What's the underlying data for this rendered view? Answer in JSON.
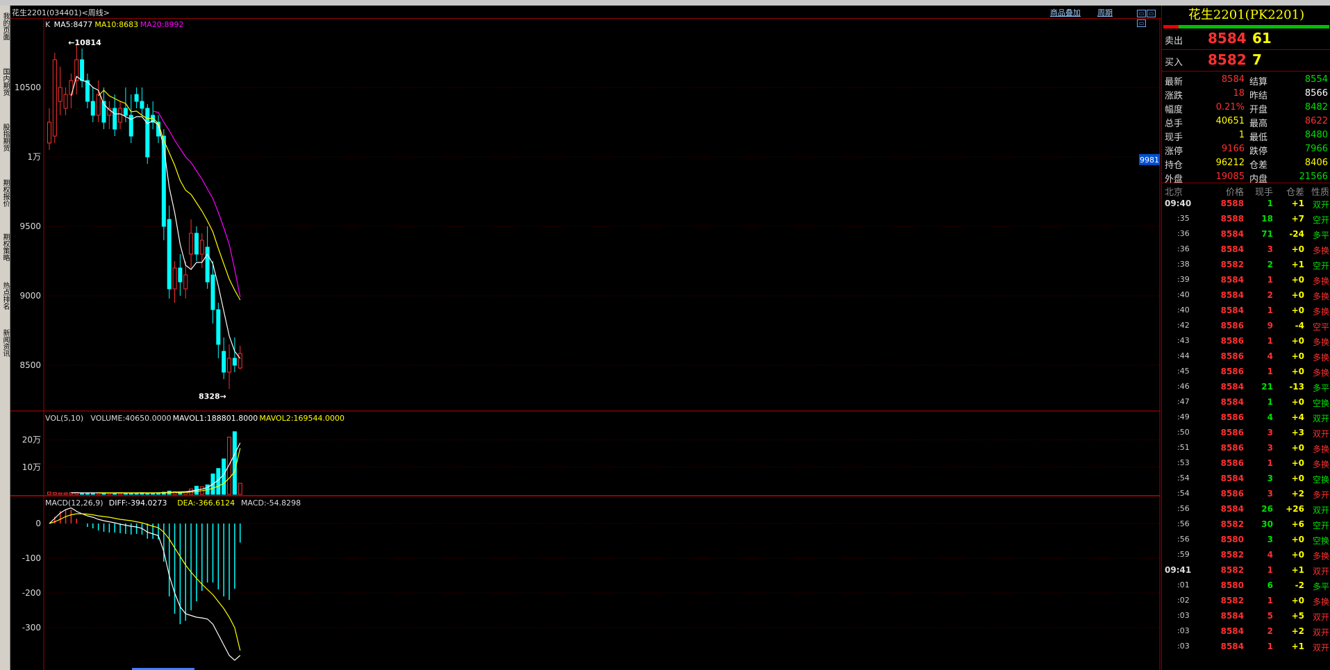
{
  "window": {
    "title": "花生2201(034401)<周线>",
    "links": [
      "商品叠加",
      "周期"
    ]
  },
  "sidebar": {
    "tabs": [
      "我的页面",
      "国内期货",
      "股指期货",
      "期权报价",
      "期权策略",
      "热点排名",
      "新闻资讯"
    ]
  },
  "main_chart": {
    "legend_k": "K",
    "ma5_label": "MA5:8477",
    "ma10_label": "MA10:8683",
    "ma20_label": "MA20:8992",
    "high_annotation": "10814",
    "low_annotation": "8328",
    "y_ticks": [
      {
        "value": 10500,
        "label": "10500"
      },
      {
        "value": 10000,
        "label": "1万"
      },
      {
        "value": 9500,
        "label": "9500"
      },
      {
        "value": 9000,
        "label": "9000"
      },
      {
        "value": 8500,
        "label": "8500"
      }
    ],
    "right_price_tag": "9981",
    "colors": {
      "up": "#ff3030",
      "down": "#00ffff",
      "ma5": "#ffffff",
      "ma10": "#ffff00",
      "ma20": "#ff00ff"
    }
  },
  "vol_panel": {
    "legend_vol": "VOL(5,10)",
    "legend_volume": "VOLUME:40650.0000",
    "legend_mavol1": "MAVOL1:188801.8000",
    "legend_mavol2": "MAVOL2:169544.0000",
    "y_ticks": [
      {
        "value": 200000,
        "label": "20万"
      },
      {
        "value": 100000,
        "label": "10万"
      }
    ]
  },
  "macd_panel": {
    "legend_macd": "MACD(12,26,9)",
    "legend_diff": "DIFF:-394.0273",
    "legend_dea": "DEA:-366.6124",
    "legend_val": "MACD:-54.8298",
    "y_ticks": [
      {
        "value": 0,
        "label": "0"
      },
      {
        "value": -100,
        "label": "-100"
      },
      {
        "value": -200,
        "label": "-200"
      },
      {
        "value": -300,
        "label": "-300"
      }
    ]
  },
  "chart_data": {
    "type": "candlestick",
    "instrument": "花生2201(034401)",
    "period": "周线",
    "ylim": [
      8300,
      10900
    ],
    "high": 10814,
    "low": 8328,
    "candles": [
      {
        "o": 10100,
        "h": 10350,
        "l": 10050,
        "c": 10250
      },
      {
        "o": 10150,
        "h": 10750,
        "l": 10100,
        "c": 10700
      },
      {
        "o": 10400,
        "h": 10650,
        "l": 10300,
        "c": 10500
      },
      {
        "o": 10350,
        "h": 10500,
        "l": 10300,
        "c": 10450
      },
      {
        "o": 10450,
        "h": 10600,
        "l": 10350,
        "c": 10550
      },
      {
        "o": 10550,
        "h": 10814,
        "l": 10450,
        "c": 10700
      },
      {
        "o": 10700,
        "h": 10780,
        "l": 10500,
        "c": 10550
      },
      {
        "o": 10550,
        "h": 10600,
        "l": 10350,
        "c": 10400
      },
      {
        "o": 10400,
        "h": 10500,
        "l": 10250,
        "c": 10300
      },
      {
        "o": 10300,
        "h": 10550,
        "l": 10250,
        "c": 10450
      },
      {
        "o": 10400,
        "h": 10500,
        "l": 10200,
        "c": 10250
      },
      {
        "o": 10300,
        "h": 10400,
        "l": 10200,
        "c": 10350
      },
      {
        "o": 10350,
        "h": 10450,
        "l": 10150,
        "c": 10200
      },
      {
        "o": 10250,
        "h": 10400,
        "l": 10200,
        "c": 10350
      },
      {
        "o": 10350,
        "h": 10500,
        "l": 10250,
        "c": 10300
      },
      {
        "o": 10300,
        "h": 10450,
        "l": 10100,
        "c": 10150
      },
      {
        "o": 10450,
        "h": 10500,
        "l": 10350,
        "c": 10400
      },
      {
        "o": 10400,
        "h": 10500,
        "l": 10300,
        "c": 10350
      },
      {
        "o": 10350,
        "h": 10380,
        "l": 9950,
        "c": 10000
      },
      {
        "o": 10300,
        "h": 10400,
        "l": 10200,
        "c": 10250
      },
      {
        "o": 10250,
        "h": 10300,
        "l": 10100,
        "c": 10150
      },
      {
        "o": 10150,
        "h": 10200,
        "l": 9400,
        "c": 9500
      },
      {
        "o": 9550,
        "h": 9650,
        "l": 8980,
        "c": 9050
      },
      {
        "o": 9050,
        "h": 9250,
        "l": 8950,
        "c": 9200
      },
      {
        "o": 9200,
        "h": 9300,
        "l": 9000,
        "c": 9100
      },
      {
        "o": 9050,
        "h": 9250,
        "l": 8980,
        "c": 9150
      },
      {
        "o": 9300,
        "h": 9550,
        "l": 9200,
        "c": 9450
      },
      {
        "o": 9450,
        "h": 9500,
        "l": 9250,
        "c": 9300
      },
      {
        "o": 9300,
        "h": 9450,
        "l": 9200,
        "c": 9400
      },
      {
        "o": 9350,
        "h": 9500,
        "l": 9050,
        "c": 9100
      },
      {
        "o": 9150,
        "h": 9250,
        "l": 8800,
        "c": 8900
      },
      {
        "o": 8900,
        "h": 8950,
        "l": 8550,
        "c": 8650
      },
      {
        "o": 8600,
        "h": 8700,
        "l": 8400,
        "c": 8450
      },
      {
        "o": 8450,
        "h": 8650,
        "l": 8328,
        "c": 8550
      },
      {
        "o": 8550,
        "h": 8700,
        "l": 8450,
        "c": 8500
      },
      {
        "o": 8480,
        "h": 8640,
        "l": 8470,
        "c": 8584
      }
    ],
    "ma5": [
      null,
      null,
      null,
      null,
      10440,
      10580,
      10550,
      10540,
      10500,
      10480,
      10380,
      10340,
      10310,
      10310,
      10290,
      10270,
      10290,
      10290,
      10240,
      10260,
      10230,
      10070,
      9780,
      9600,
      9370,
      9220,
      9190,
      9240,
      9240,
      9300,
      9230,
      9070,
      8890,
      8710,
      8600,
      8548
    ],
    "ma10": [
      null,
      null,
      null,
      null,
      null,
      null,
      null,
      null,
      null,
      10440,
      10480,
      10440,
      10420,
      10400,
      10385,
      10325,
      10330,
      10300,
      10275,
      10280,
      10240,
      10120,
      10030,
      9940,
      9830,
      9760,
      9730,
      9670,
      9610,
      9540,
      9460,
      9340,
      9230,
      9120,
      9040,
      8970
    ],
    "ma20": [
      null,
      null,
      null,
      null,
      null,
      null,
      null,
      null,
      null,
      null,
      null,
      null,
      null,
      null,
      null,
      null,
      null,
      null,
      null,
      10330,
      10320,
      10250,
      10190,
      10120,
      10060,
      10000,
      9960,
      9900,
      9840,
      9770,
      9700,
      9600,
      9490,
      9370,
      9190,
      8992
    ],
    "volume": [
      8000,
      6000,
      5000,
      5000,
      6000,
      7000,
      5000,
      5000,
      5000,
      6000,
      5000,
      5000,
      5000,
      6000,
      5000,
      5000,
      5000,
      6000,
      5000,
      5000,
      6000,
      8000,
      12000,
      10000,
      9000,
      10000,
      20000,
      30000,
      28000,
      35000,
      75000,
      95000,
      130000,
      210000,
      230000,
      40650
    ],
    "mavol1": [
      null,
      null,
      null,
      null,
      6000,
      5800,
      5600,
      5600,
      5600,
      5600,
      5200,
      5200,
      5200,
      5400,
      5200,
      5200,
      5200,
      5400,
      5200,
      5200,
      5400,
      6000,
      7200,
      8200,
      9000,
      9800,
      12200,
      15800,
      19400,
      24600,
      37600,
      52600,
      72600,
      109000,
      148000,
      188802
    ],
    "mavol2": [
      null,
      null,
      null,
      null,
      null,
      null,
      null,
      null,
      null,
      5800,
      5500,
      5400,
      5400,
      5500,
      5400,
      5300,
      5300,
      5400,
      5300,
      5300,
      5300,
      5600,
      6300,
      6800,
      7100,
      7500,
      8700,
      11000,
      13300,
      16700,
      22500,
      30300,
      39900,
      59600,
      83300,
      169544
    ],
    "diff": [
      0,
      15,
      30,
      40,
      45,
      35,
      28,
      22,
      18,
      12,
      8,
      5,
      2,
      -2,
      -5,
      -8,
      -10,
      -14,
      -25,
      -30,
      -35,
      -80,
      -150,
      -200,
      -240,
      -260,
      -265,
      -270,
      -272,
      -275,
      -290,
      -320,
      -350,
      -380,
      -394,
      -380
    ],
    "dea": [
      0,
      5,
      12,
      20,
      25,
      28,
      28,
      27,
      25,
      22,
      20,
      18,
      15,
      12,
      10,
      8,
      5,
      2,
      -3,
      -8,
      -12,
      -25,
      -45,
      -70,
      -95,
      -120,
      -140,
      -158,
      -175,
      -190,
      -205,
      -225,
      -245,
      -270,
      -300,
      -366
    ],
    "macd": [
      0,
      20,
      36,
      40,
      40,
      14,
      0,
      -10,
      -14,
      -20,
      -24,
      -26,
      -26,
      -28,
      -30,
      -32,
      -30,
      -32,
      -44,
      -44,
      -46,
      -110,
      -210,
      -260,
      -290,
      -280,
      -250,
      -224,
      -194,
      -170,
      -170,
      -190,
      -210,
      -220,
      -188,
      -55
    ]
  },
  "quote_panel": {
    "title": "花生2201(PK2201)",
    "ask_label": "卖出",
    "ask_price": "8584",
    "ask_vol": "61",
    "bid_label": "买入",
    "bid_price": "8582",
    "bid_vol": "7",
    "rows": [
      {
        "l1": "最新",
        "v1": "8584",
        "c1": "red",
        "l2": "结算",
        "v2": "8554",
        "c2": "green"
      },
      {
        "l1": "涨跌",
        "v1": "18",
        "c1": "red",
        "l2": "昨结",
        "v2": "8566",
        "c2": "white"
      },
      {
        "l1": "幅度",
        "v1": "0.21%",
        "c1": "red",
        "l2": "开盘",
        "v2": "8482",
        "c2": "green"
      },
      {
        "l1": "总手",
        "v1": "40651",
        "c1": "yellow",
        "l2": "最高",
        "v2": "8622",
        "c2": "red"
      },
      {
        "l1": "现手",
        "v1": "1",
        "c1": "yellow",
        "l2": "最低",
        "v2": "8480",
        "c2": "green"
      },
      {
        "l1": "涨停",
        "v1": "9166",
        "c1": "red",
        "l2": "跌停",
        "v2": "7966",
        "c2": "green"
      },
      {
        "l1": "持仓",
        "v1": "96212",
        "c1": "yellow",
        "l2": "仓差",
        "v2": "8406",
        "c2": "yellow"
      },
      {
        "l1": "外盘",
        "v1": "19085",
        "c1": "red",
        "l2": "内盘",
        "v2": "21566",
        "c2": "green"
      }
    ],
    "tick_headers": [
      "北京",
      "价格",
      "现手",
      "仓差",
      "性质"
    ],
    "ticks": [
      {
        "t": "09:40",
        "p": "8588",
        "v": "1",
        "vc": "green",
        "oi": "+1",
        "n": "双开",
        "nc": "green",
        "main": true
      },
      {
        "t": ":35",
        "p": "8588",
        "v": "18",
        "vc": "green",
        "oi": "+7",
        "n": "空开",
        "nc": "green"
      },
      {
        "t": ":36",
        "p": "8584",
        "v": "71",
        "vc": "green",
        "oi": "-24",
        "n": "多平",
        "nc": "green"
      },
      {
        "t": ":36",
        "p": "8584",
        "v": "3",
        "vc": "red",
        "oi": "+0",
        "n": "多换",
        "nc": "red"
      },
      {
        "t": ":38",
        "p": "8582",
        "v": "2",
        "vc": "green",
        "oi": "+1",
        "n": "空开",
        "nc": "green"
      },
      {
        "t": ":39",
        "p": "8584",
        "v": "1",
        "vc": "red",
        "oi": "+0",
        "n": "多换",
        "nc": "red"
      },
      {
        "t": ":40",
        "p": "8584",
        "v": "2",
        "vc": "red",
        "oi": "+0",
        "n": "多换",
        "nc": "red"
      },
      {
        "t": ":40",
        "p": "8584",
        "v": "1",
        "vc": "red",
        "oi": "+0",
        "n": "多换",
        "nc": "red"
      },
      {
        "t": ":42",
        "p": "8586",
        "v": "9",
        "vc": "red",
        "oi": "-4",
        "n": "空平",
        "nc": "red"
      },
      {
        "t": ":43",
        "p": "8586",
        "v": "1",
        "vc": "red",
        "oi": "+0",
        "n": "多换",
        "nc": "red"
      },
      {
        "t": ":44",
        "p": "8586",
        "v": "4",
        "vc": "red",
        "oi": "+0",
        "n": "多换",
        "nc": "red"
      },
      {
        "t": ":45",
        "p": "8586",
        "v": "1",
        "vc": "red",
        "oi": "+0",
        "n": "多换",
        "nc": "red"
      },
      {
        "t": ":46",
        "p": "8584",
        "v": "21",
        "vc": "green",
        "oi": "-13",
        "n": "多平",
        "nc": "green"
      },
      {
        "t": ":47",
        "p": "8584",
        "v": "1",
        "vc": "green",
        "oi": "+0",
        "n": "空换",
        "nc": "green"
      },
      {
        "t": ":49",
        "p": "8586",
        "v": "4",
        "vc": "green",
        "oi": "+4",
        "n": "双开",
        "nc": "green"
      },
      {
        "t": ":50",
        "p": "8586",
        "v": "3",
        "vc": "red",
        "oi": "+3",
        "n": "双开",
        "nc": "red"
      },
      {
        "t": ":51",
        "p": "8586",
        "v": "3",
        "vc": "red",
        "oi": "+0",
        "n": "多换",
        "nc": "red"
      },
      {
        "t": ":53",
        "p": "8586",
        "v": "1",
        "vc": "red",
        "oi": "+0",
        "n": "多换",
        "nc": "red"
      },
      {
        "t": ":54",
        "p": "8584",
        "v": "3",
        "vc": "green",
        "oi": "+0",
        "n": "空换",
        "nc": "green"
      },
      {
        "t": ":54",
        "p": "8586",
        "v": "3",
        "vc": "red",
        "oi": "+2",
        "n": "多开",
        "nc": "red"
      },
      {
        "t": ":56",
        "p": "8584",
        "v": "26",
        "vc": "green",
        "oi": "+26",
        "n": "双开",
        "nc": "green"
      },
      {
        "t": ":56",
        "p": "8582",
        "v": "30",
        "vc": "green",
        "oi": "+6",
        "n": "空开",
        "nc": "green"
      },
      {
        "t": ":56",
        "p": "8580",
        "v": "3",
        "vc": "green",
        "oi": "+0",
        "n": "空换",
        "nc": "green"
      },
      {
        "t": ":59",
        "p": "8582",
        "v": "4",
        "vc": "red",
        "oi": "+0",
        "n": "多换",
        "nc": "red"
      },
      {
        "t": "09:41",
        "p": "8582",
        "v": "1",
        "vc": "red",
        "oi": "+1",
        "n": "双开",
        "nc": "red",
        "main": true
      },
      {
        "t": ":01",
        "p": "8580",
        "v": "6",
        "vc": "green",
        "oi": "-2",
        "n": "多平",
        "nc": "green"
      },
      {
        "t": ":02",
        "p": "8582",
        "v": "1",
        "vc": "red",
        "oi": "+0",
        "n": "多换",
        "nc": "red"
      },
      {
        "t": ":03",
        "p": "8584",
        "v": "5",
        "vc": "red",
        "oi": "+5",
        "n": "双开",
        "nc": "red"
      },
      {
        "t": ":03",
        "p": "8584",
        "v": "2",
        "vc": "red",
        "oi": "+2",
        "n": "双开",
        "nc": "red"
      },
      {
        "t": ":03",
        "p": "8584",
        "v": "1",
        "vc": "red",
        "oi": "+1",
        "n": "双开",
        "nc": "red"
      }
    ]
  }
}
